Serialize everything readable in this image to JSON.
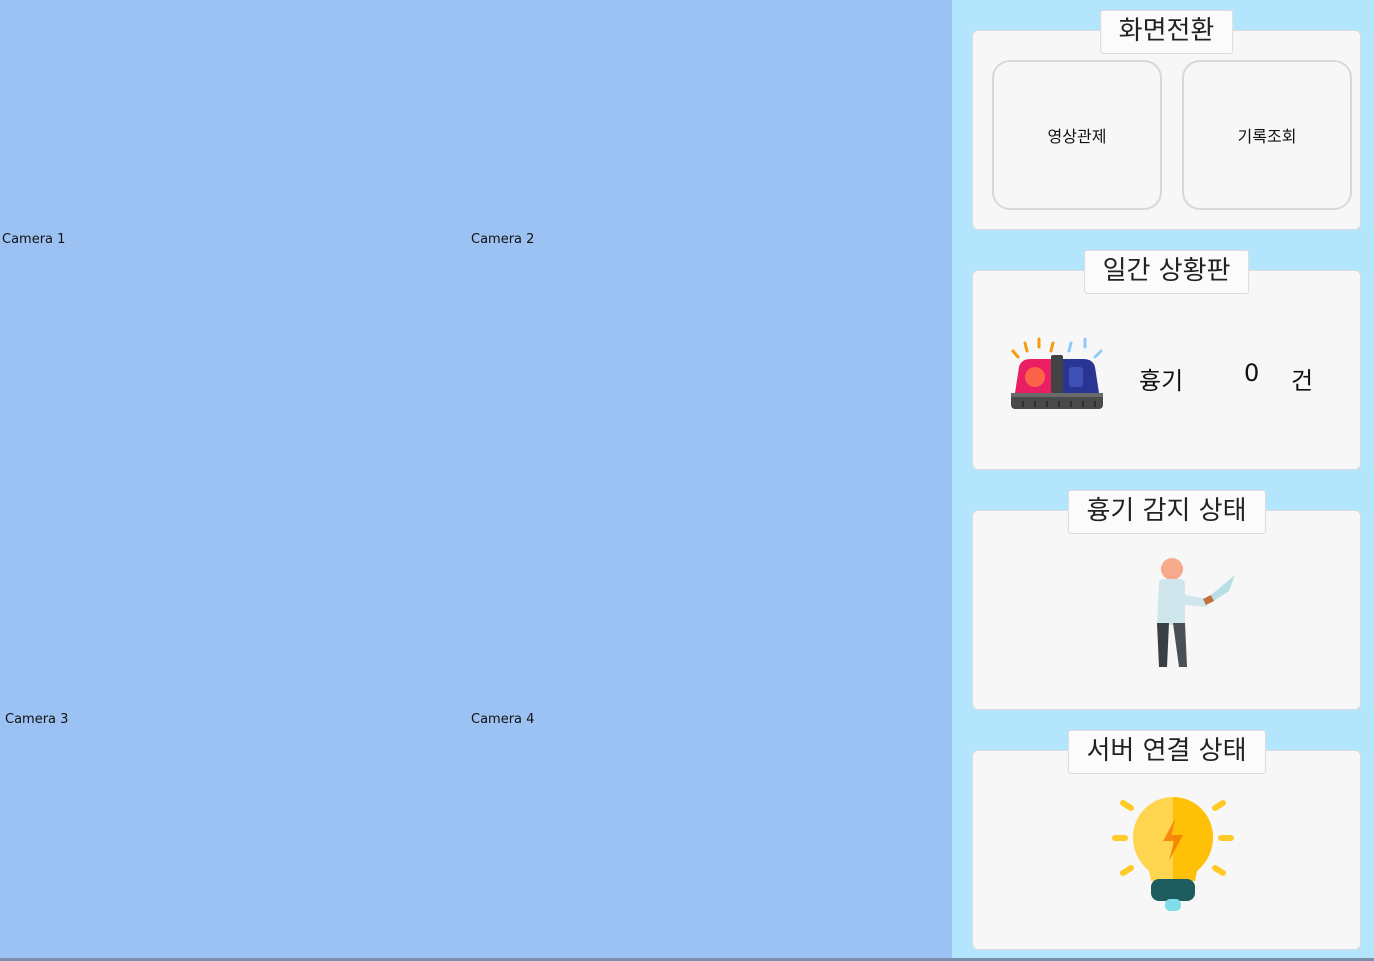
{
  "cameras": [
    {
      "label": "Camera 1"
    },
    {
      "label": "Camera 2"
    },
    {
      "label": "Camera 3"
    },
    {
      "label": "Camera 4"
    }
  ],
  "screen_switch": {
    "title": "화면전환",
    "video_control_label": "영상관제",
    "record_query_label": "기록조회"
  },
  "daily_board": {
    "title": "일간 상황판",
    "weapon_label": "흉기",
    "weapon_count": "0",
    "count_unit": "건",
    "icon": "siren-icon"
  },
  "weapon_detect": {
    "title": "흉기 감지 상태",
    "icon": "person-with-knife-icon"
  },
  "server_status": {
    "title": "서버 연결 상태",
    "icon": "lightbulb-icon"
  },
  "colors": {
    "camera_bg": "#9bc2f2",
    "panel_bg": "#b3e5fc",
    "group_bg": "#f7f7f7"
  }
}
